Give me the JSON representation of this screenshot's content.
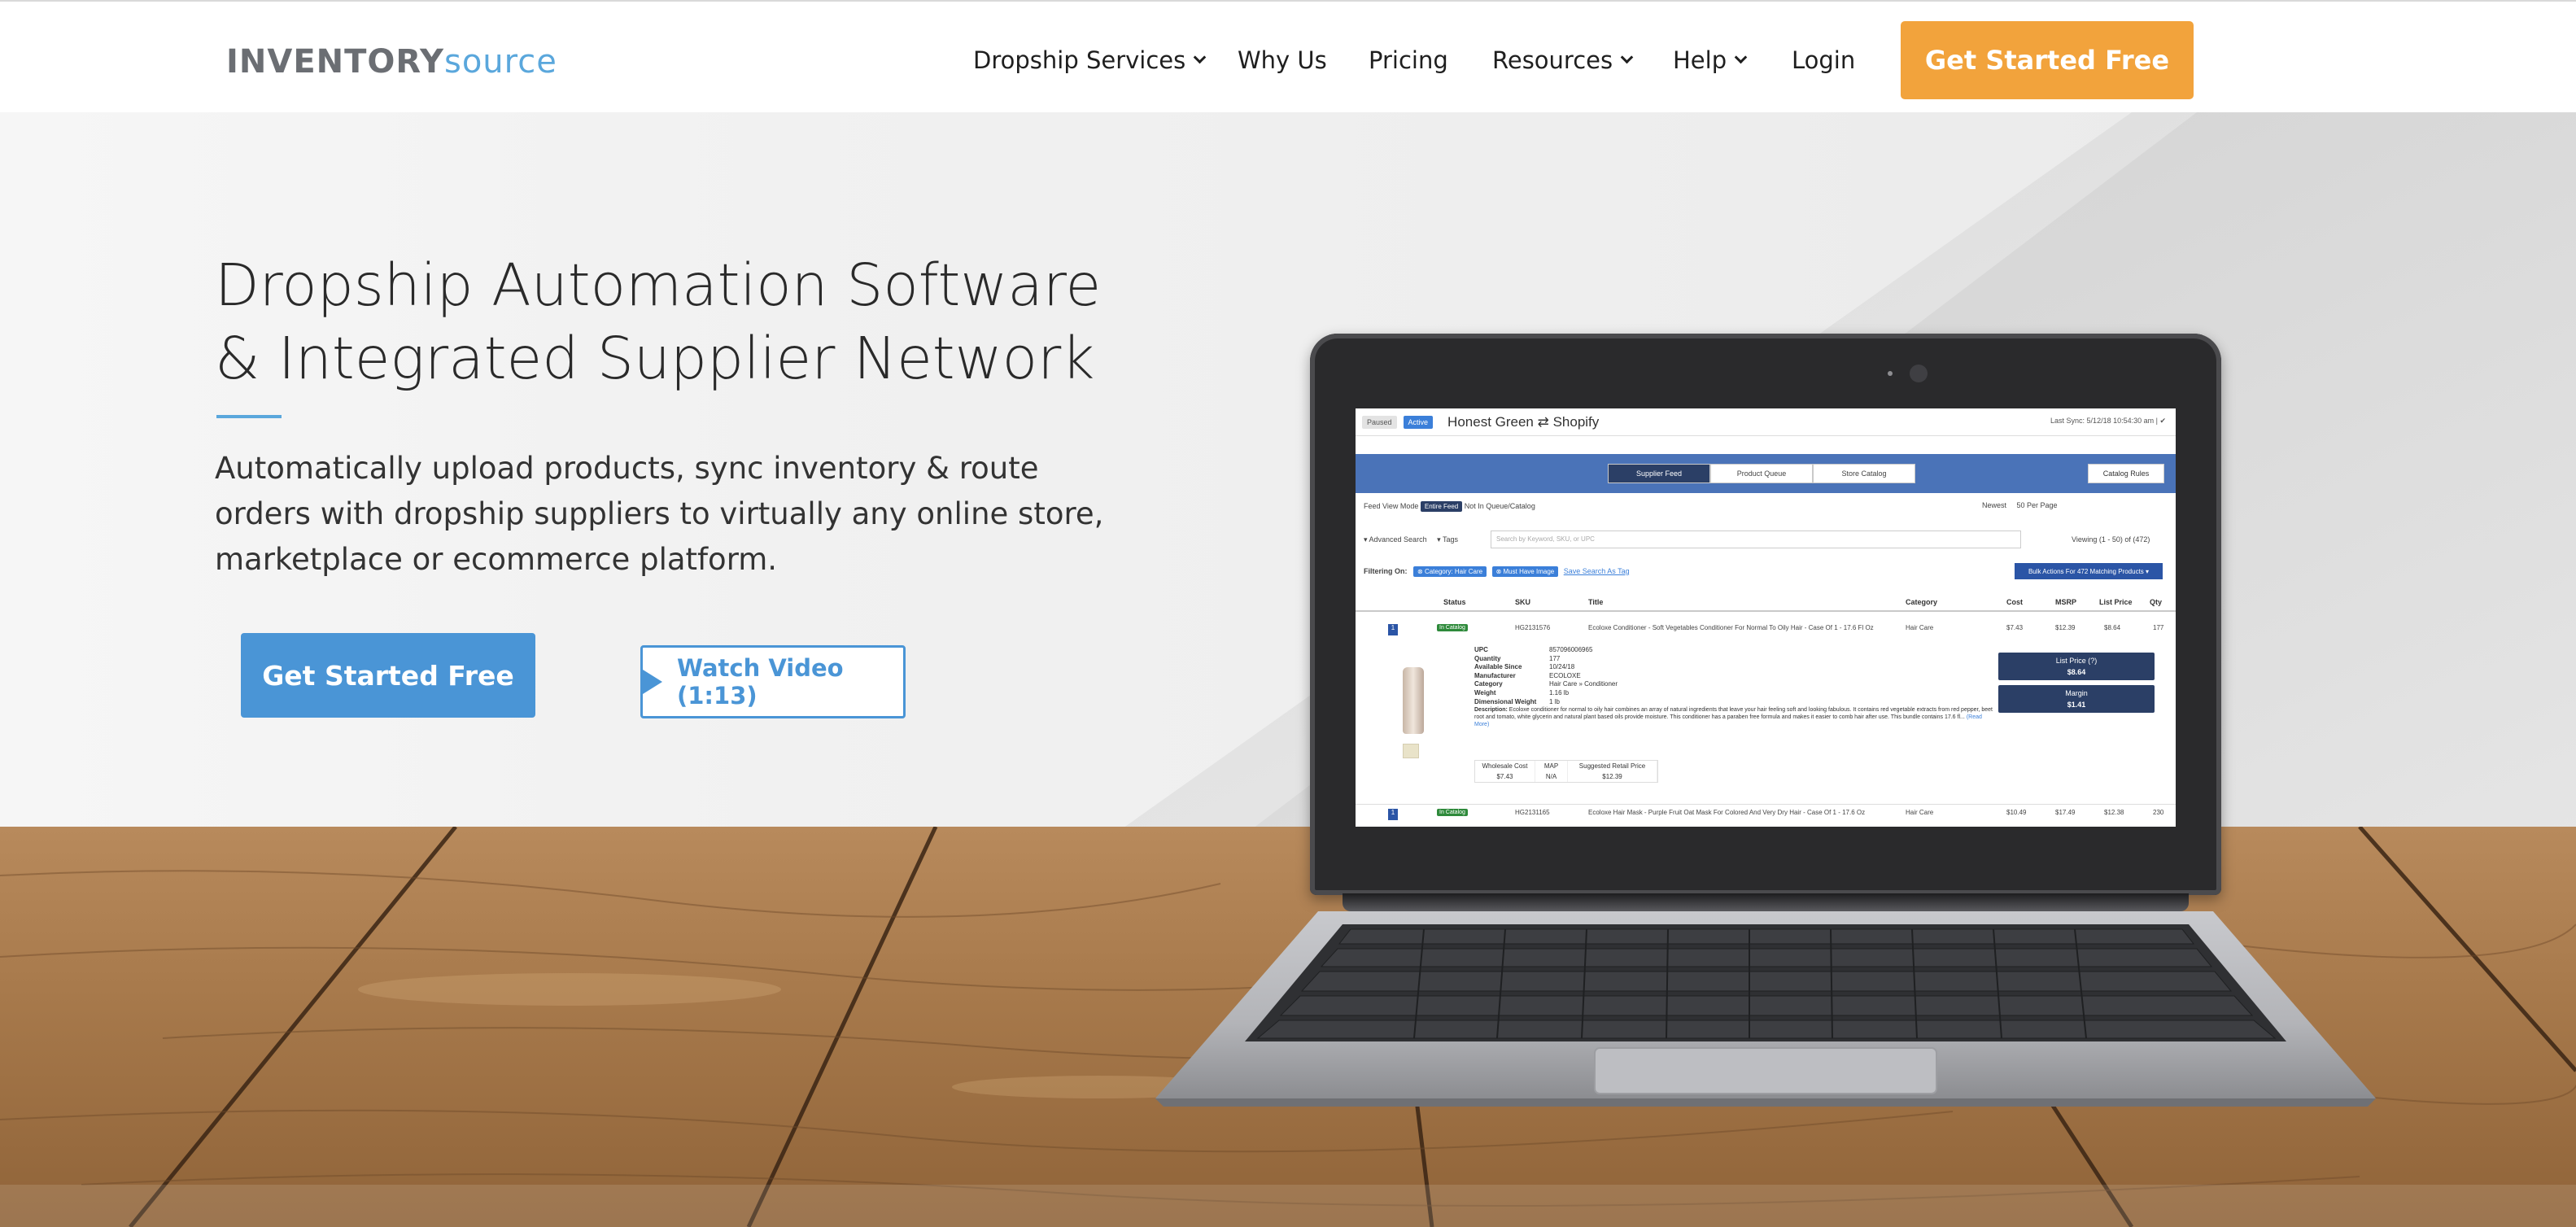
{
  "header": {
    "logo_part1": "INVENTORY",
    "logo_part2": "source",
    "nav": [
      {
        "label": "Dropship Services",
        "has_dropdown": true
      },
      {
        "label": "Why Us",
        "has_dropdown": false
      },
      {
        "label": "Pricing",
        "has_dropdown": false
      },
      {
        "label": "Resources",
        "has_dropdown": true
      },
      {
        "label": "Help",
        "has_dropdown": true
      },
      {
        "label": "Login",
        "has_dropdown": false
      }
    ],
    "cta_label": "Get Started Free"
  },
  "hero": {
    "title_line1": "Dropship Automation Software",
    "title_line2": "& Integrated Supplier Network",
    "subtitle": "Automatically upload products, sync inventory & route orders with dropship suppliers to virtually any online store, marketplace or ecommerce platform.",
    "primary_button": "Get Started Free",
    "video_button": "Watch Video (1:13)"
  },
  "laptop_screen": {
    "status_paused": "Paused",
    "status_active": "Active",
    "store_name": "Honest Green ⇄ Shopify",
    "last_sync": "Last Sync: 5/12/18 10:54:30 am | ✔",
    "tabs": [
      "Supplier Feed",
      "Product Queue",
      "Store Catalog"
    ],
    "catalog_rules": "Catalog Rules",
    "feed_view_mode": "Feed View Mode",
    "entire_feed": "Entire Feed",
    "not_in_queue": "Not In Queue/Catalog",
    "newest": "Newest",
    "per_page": "50 Per Page",
    "advanced_search": "▾ Advanced Search",
    "tags": "▾ Tags",
    "search_placeholder": "Search by Keyword, SKU, or UPC",
    "viewing": "Viewing (1 - 50) of (472)",
    "filtering_on": "Filtering On:",
    "filter1": "⊗ Category: Hair Care",
    "filter2": "⊗ Must Have Image",
    "save_search": "Save Search As Tag",
    "bulk_actions": "Bulk Actions For 472 Matching Products ▾",
    "columns": [
      "Status",
      "SKU",
      "Title",
      "Category",
      "Cost",
      "MSRP",
      "List Price",
      "Qty"
    ],
    "rows": [
      {
        "num": "1",
        "tag": "In Catalog",
        "sku": "HG2131576",
        "title": "Ecoloxe Conditioner - Soft Vegetables Conditioner For Normal To Oily Hair - Case Of 1 - 17.6 Fl Oz",
        "category": "Hair Care",
        "cost": "$7.43",
        "msrp": "$12.39",
        "list": "$8.64",
        "qty": "177"
      },
      {
        "num": "1",
        "tag": "In Catalog",
        "sku": "HG2131165",
        "title": "Ecoloxe Hair Mask - Purple Fruit Oat Mask For Colored And Very Dry Hair - Case Of 1 - 17.6 Oz",
        "category": "Hair Care",
        "cost": "$10.49",
        "msrp": "$17.49",
        "list": "$12.38",
        "qty": "230"
      }
    ],
    "detail": {
      "upc": [
        "UPC",
        "857096006965"
      ],
      "quantity": [
        "Quantity",
        "177"
      ],
      "available_since": [
        "Available Since",
        "10/24/18"
      ],
      "manufacturer": [
        "Manufacturer",
        "ECOLOXE"
      ],
      "category": [
        "Category",
        "Hair Care » Conditioner"
      ],
      "weight": [
        "Weight",
        "1.16 lb"
      ],
      "dimensional_weight": [
        "Dimensional Weight",
        "1 lb"
      ],
      "description_label": "Description:",
      "description": "Ecoloxe conditioner for normal to oily hair combines an array of natural ingredients that leave your hair feeling soft and looking fabulous. It contains red vegetable extracts from red pepper, beet root and tomato, white glycerin and natural plant based oils provide moisture. This conditioner has a paraben free formula and makes it easier to comb hair after use. This bundle contains 17.6 fl...",
      "read_more": "(Read More)"
    },
    "price_box1_label": "List Price (?)",
    "price_box1_value": "$8.64",
    "price_box2_label": "Margin",
    "price_box2_value": "$1.41",
    "pricing_table": {
      "headers": [
        "Wholesale Cost",
        "MAP",
        "Suggested Retail Price"
      ],
      "values": [
        "$7.43",
        "N/A",
        "$12.39"
      ]
    }
  }
}
